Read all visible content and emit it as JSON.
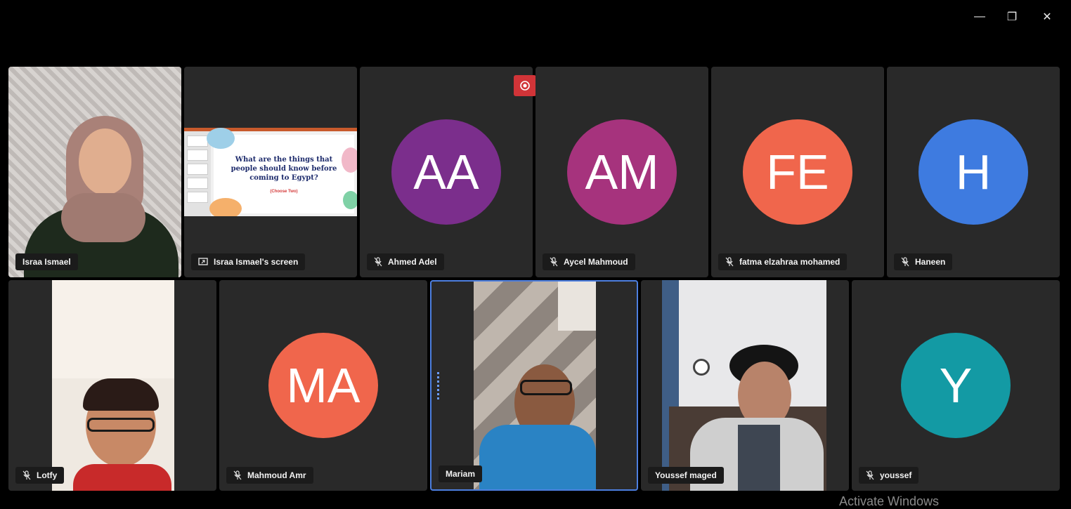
{
  "window_controls": {
    "minimize": "—",
    "restore": "❐",
    "close": "✕"
  },
  "record_icon": "record-icon",
  "shared_screen": {
    "slide_title": "What are the things that people should know before coming to Egypt?",
    "slide_subtitle": "(Choose Two)"
  },
  "tiles": [
    {
      "name": "Israa Ismael",
      "type": "video",
      "mic": false
    },
    {
      "name": "Israa Ismael's screen",
      "type": "screen"
    },
    {
      "name": "Ahmed Adel",
      "type": "avatar",
      "initials": "AA",
      "color": "#7b2e8c",
      "mic": true
    },
    {
      "name": "Aycel Mahmoud",
      "type": "avatar",
      "initials": "AM",
      "color": "#a6337d",
      "mic": true
    },
    {
      "name": "fatma elzahraa mohamed",
      "type": "avatar",
      "initials": "FE",
      "color": "#f0664c",
      "mic": true
    },
    {
      "name": "Haneen",
      "type": "avatar",
      "initials": "H",
      "color": "#3e7be0",
      "mic": true
    },
    {
      "name": "Lotfy",
      "type": "video",
      "mic": true
    },
    {
      "name": "Mahmoud Amr",
      "type": "avatar",
      "initials": "MA",
      "color": "#f0664c",
      "mic": true
    },
    {
      "name": "Mariam",
      "type": "video",
      "mic": false,
      "active": true
    },
    {
      "name": "Youssef maged",
      "type": "video",
      "mic": false
    },
    {
      "name": "youssef",
      "type": "avatar",
      "initials": "Y",
      "color": "#139aa4",
      "mic": true
    }
  ],
  "watermark": "Activate Windows"
}
